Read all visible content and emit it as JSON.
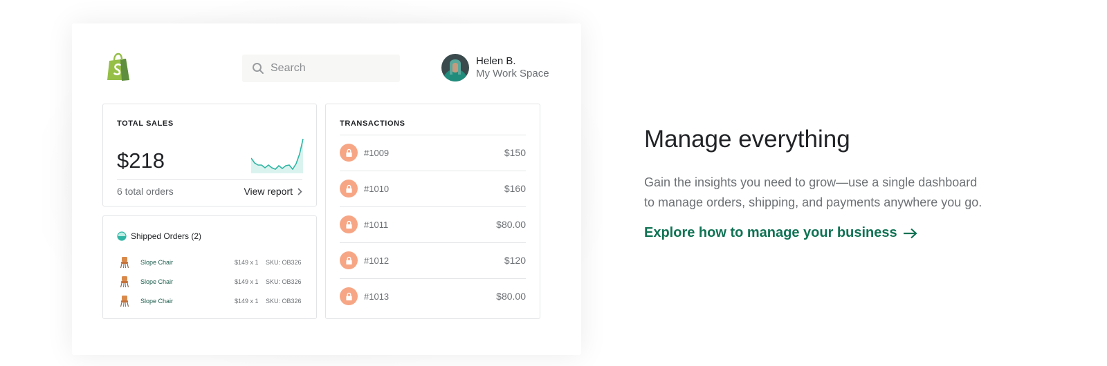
{
  "dashboard": {
    "search": {
      "placeholder": "Search"
    },
    "user": {
      "name": "Helen B.",
      "workspace": "My Work Space"
    },
    "total_sales": {
      "title": "TOTAL SALES",
      "amount": "$218",
      "orders": "6 total orders",
      "view_report": "View report"
    },
    "shipped": {
      "title": "Shipped Orders (2)",
      "items": [
        {
          "name": "Slope Chair",
          "price": "$149 x 1",
          "sku": "SKU: OB326"
        },
        {
          "name": "Slope Chair",
          "price": "$149 x 1",
          "sku": "SKU: OB326"
        },
        {
          "name": "Slope Chair",
          "price": "$149 x 1",
          "sku": "SKU: OB326"
        }
      ]
    },
    "transactions": {
      "title": "TRANSACTIONS",
      "items": [
        {
          "id": "#1009",
          "amount": "$150"
        },
        {
          "id": "#1010",
          "amount": "$160"
        },
        {
          "id": "#1011",
          "amount": "$80.00"
        },
        {
          "id": "#1012",
          "amount": "$120"
        },
        {
          "id": "#1013",
          "amount": "$80.00"
        }
      ]
    }
  },
  "promo": {
    "title": "Manage everything",
    "text": "Gain the insights you need to grow—use a single dashboard to manage orders, shipping, and payments anywhere you go.",
    "link": "Explore how to manage your business"
  },
  "colors": {
    "brand_green": "#95bf47",
    "link_green": "#0f7253",
    "sparkline": "#2fb6a4",
    "tx_icon": "#f7a685"
  },
  "icons": {
    "logo": "shopify-bag-icon",
    "search": "search-icon",
    "chevron": "chevron-right-icon",
    "shipped": "half-circle-icon",
    "chair": "chair-icon",
    "lock": "lock-icon",
    "arrow": "arrow-right-icon"
  }
}
